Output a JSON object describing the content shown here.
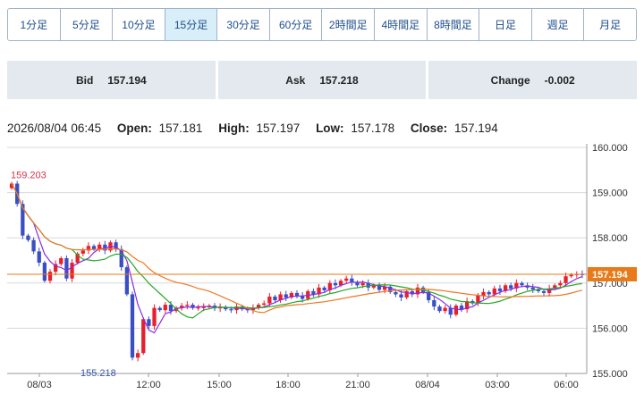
{
  "timeframes": [
    "1分足",
    "5分足",
    "10分足",
    "15分足",
    "30分足",
    "60分足",
    "2時間足",
    "4時間足",
    "8時間足",
    "日足",
    "週足",
    "月足"
  ],
  "active_timeframe": "15分足",
  "quote": {
    "bid_label": "Bid",
    "bid": "157.194",
    "ask_label": "Ask",
    "ask": "157.218",
    "change_label": "Change",
    "change": "-0.002"
  },
  "ohlc": {
    "datetime": "2026/08/04 06:45",
    "open_label": "Open:",
    "open": "157.181",
    "high_label": "High:",
    "high": "157.197",
    "low_label": "Low:",
    "low": "157.178",
    "close_label": "Close:",
    "close": "157.194"
  },
  "colors": {
    "up": "#e8202c",
    "down": "#3a4fc4",
    "ma_short": "#8a2be2",
    "ma_mid": "#22aa22",
    "ma_long": "#ee7722",
    "price_line": "#e87a1a"
  },
  "chart_data": {
    "type": "candlestick",
    "ylim": [
      155.0,
      160.0
    ],
    "y_ticks": [
      "160.000",
      "159.000",
      "158.000",
      "157.000",
      "156.000",
      "155.000"
    ],
    "x_ticks": [
      "08/03",
      "12:00",
      "15:00",
      "18:00",
      "21:00",
      "08/04",
      "03:00",
      "06:00"
    ],
    "current_price": "157.194",
    "max_label": "159.203",
    "min_label": "155.218",
    "closes": [
      159.2,
      158.75,
      158.05,
      157.95,
      157.7,
      157.45,
      157.05,
      157.25,
      157.42,
      157.55,
      157.1,
      157.45,
      157.65,
      157.72,
      157.82,
      157.75,
      157.85,
      157.72,
      157.9,
      157.75,
      157.35,
      156.75,
      155.35,
      155.45,
      156.2,
      156.05,
      156.45,
      156.4,
      156.52,
      156.38,
      156.45,
      156.5,
      156.52,
      156.45,
      156.46,
      156.47,
      156.5,
      156.44,
      156.47,
      156.42,
      156.4,
      156.48,
      156.42,
      156.4,
      156.45,
      156.52,
      156.55,
      156.7,
      156.62,
      156.75,
      156.68,
      156.78,
      156.72,
      156.65,
      156.82,
      156.75,
      156.9,
      156.84,
      157.0,
      156.95,
      157.05,
      157.1,
      157.02,
      156.95,
      157.0,
      156.9,
      156.95,
      156.85,
      156.92,
      156.8,
      156.75,
      156.68,
      156.82,
      156.75,
      156.9,
      156.8,
      156.62,
      156.48,
      156.38,
      156.45,
      156.3,
      156.5,
      156.42,
      156.6,
      156.55,
      156.72,
      156.8,
      156.75,
      156.88,
      156.82,
      156.95,
      156.88,
      157.0,
      156.95,
      156.9,
      156.86,
      156.82,
      156.78,
      156.88,
      156.95,
      157.0,
      157.15,
      157.18,
      157.2,
      157.19
    ]
  }
}
